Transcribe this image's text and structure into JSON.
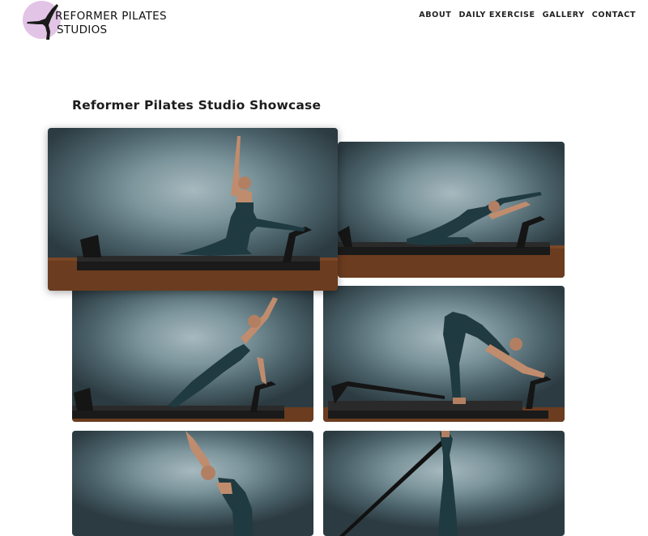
{
  "brand": {
    "name": "REFORMER PILATES\nSTUDIOS",
    "line1": "REFORMER PILATES",
    "line2": "STUDIOS",
    "logo_color": "#e2c4e6"
  },
  "nav": [
    {
      "label": "ABOUT"
    },
    {
      "label": "DAILY EXERCISE"
    },
    {
      "label": "GALLERY"
    },
    {
      "label": "CONTACT"
    }
  ],
  "page_title": "Reformer Pilates Studio Showcase",
  "gallery": {
    "photos": [
      {
        "icon": "photo-side-stretch-arm-up"
      },
      {
        "icon": "photo-side-bend-reach"
      },
      {
        "icon": "photo-side-plank-arm-up"
      },
      {
        "icon": "photo-downward-dog"
      },
      {
        "icon": "photo-standing-forward-bend"
      },
      {
        "icon": "photo-straps-leg-lift"
      }
    ],
    "colors": {
      "wall": "#7d959c",
      "floor": "#6a3a1e",
      "outfit": "#1f3a40",
      "machine": "#1a1a1a"
    }
  }
}
